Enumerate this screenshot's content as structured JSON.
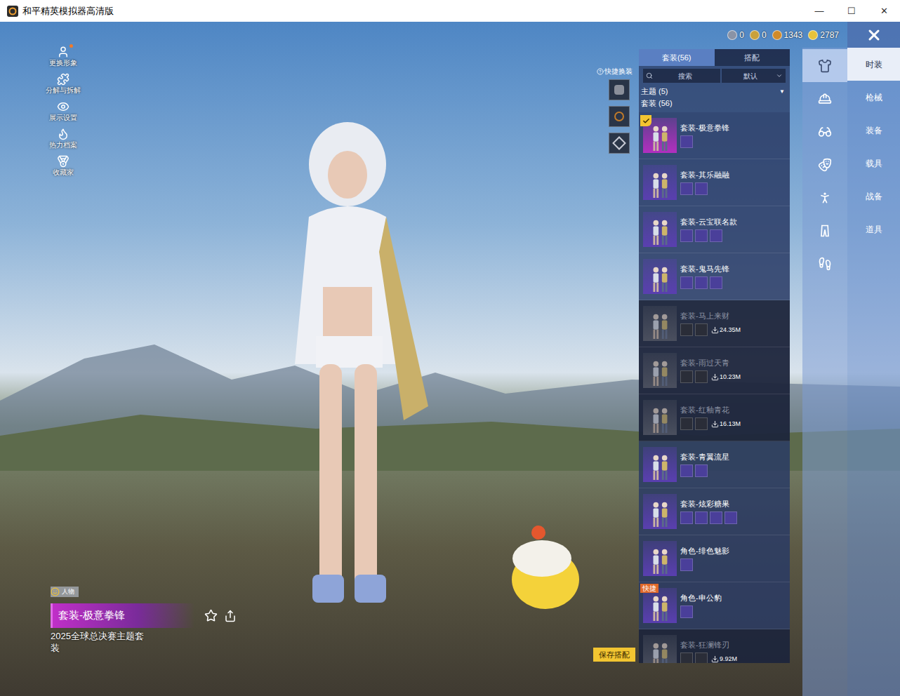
{
  "window": {
    "title": "和平精英模拟器高清版",
    "controls": [
      "—",
      "☐",
      "✕"
    ]
  },
  "left_menu": [
    {
      "label": "更换形象",
      "dot": true,
      "kind": "avatar"
    },
    {
      "label": "分解与拆解",
      "dot": false,
      "kind": "puzzle"
    },
    {
      "label": "展示设置",
      "dot": false,
      "kind": "eye"
    },
    {
      "label": "热力档案",
      "dot": false,
      "kind": "flame"
    },
    {
      "label": "收藏家",
      "dot": false,
      "kind": "medal"
    }
  ],
  "currencies": [
    {
      "value": "0",
      "color": "#8a93a6"
    },
    {
      "value": "0",
      "color": "#c9a13b"
    },
    {
      "value": "1343",
      "color": "#d08a2a"
    },
    {
      "value": "2787",
      "color": "#e6c23a"
    }
  ],
  "quick_change": {
    "label": "快捷换装"
  },
  "tabs": [
    {
      "label": "套装(56)",
      "selected": true
    },
    {
      "label": "搭配",
      "selected": false
    }
  ],
  "search": {
    "placeholder": "搜索",
    "sort": "默认"
  },
  "filters": [
    {
      "label": "主题 (5)",
      "expanded": false
    },
    {
      "label": "套装 (56)"
    }
  ],
  "list": [
    {
      "name": "套装-极意拳锋",
      "parts": 1,
      "downloaded": true,
      "size": "",
      "selected": true,
      "badge": "",
      "color": "#b22fc0"
    },
    {
      "name": "套装-其乐融融",
      "parts": 2,
      "downloaded": true,
      "size": "",
      "selected": false,
      "badge": "",
      "color": "#5a3fb0"
    },
    {
      "name": "套装-云宝联名款",
      "parts": 3,
      "downloaded": true,
      "size": "",
      "selected": false,
      "badge": "",
      "color": "#5a3fb0"
    },
    {
      "name": "套装-鬼马先锋",
      "parts": 3,
      "downloaded": true,
      "size": "",
      "selected": false,
      "badge": "",
      "color": "#5a3fb0"
    },
    {
      "name": "套装-马上来财",
      "parts": 2,
      "downloaded": false,
      "size": "24.35M",
      "selected": false,
      "badge": "",
      "color": "#4a4f5e"
    },
    {
      "name": "套装-雨过天青",
      "parts": 2,
      "downloaded": false,
      "size": "10.23M",
      "selected": false,
      "badge": "",
      "color": "#4a4f5e"
    },
    {
      "name": "套装-红釉青花",
      "parts": 2,
      "downloaded": false,
      "size": "16.13M",
      "selected": false,
      "badge": "",
      "color": "#4a4f5e"
    },
    {
      "name": "套装-青翼流星",
      "parts": 2,
      "downloaded": true,
      "size": "",
      "selected": false,
      "badge": "",
      "color": "#5a3fb0"
    },
    {
      "name": "套装-炫彩糖果",
      "parts": 4,
      "downloaded": true,
      "size": "",
      "selected": false,
      "badge": "",
      "color": "#5a3fb0"
    },
    {
      "name": "角色-绯色魅影",
      "parts": 1,
      "downloaded": true,
      "size": "",
      "selected": false,
      "badge": "",
      "color": "#5a3fb0"
    },
    {
      "name": "角色-申公豹",
      "parts": 1,
      "downloaded": true,
      "size": "",
      "selected": false,
      "badge": "快捷",
      "color": "#5a3fb0"
    },
    {
      "name": "套装-狂澜锋刃",
      "parts": 2,
      "downloaded": false,
      "size": "9.92M",
      "selected": false,
      "badge": "",
      "color": "#4a4f5e"
    }
  ],
  "categories": [
    {
      "kind": "outfit",
      "selected": true
    },
    {
      "kind": "hat",
      "selected": false
    },
    {
      "kind": "glasses",
      "selected": false
    },
    {
      "kind": "mask",
      "selected": false
    },
    {
      "kind": "body",
      "selected": false
    },
    {
      "kind": "pants",
      "selected": false
    },
    {
      "kind": "shoes",
      "selected": false
    }
  ],
  "sections": [
    {
      "label": "时装",
      "selected": true
    },
    {
      "label": "枪械",
      "selected": false
    },
    {
      "label": "装备",
      "selected": false
    },
    {
      "label": "载具",
      "selected": false
    },
    {
      "label": "战备",
      "selected": false
    },
    {
      "label": "道具",
      "selected": false
    }
  ],
  "preview": {
    "tag": "人物",
    "name": "套装-极意拳锋",
    "description": "2025全球总决赛主题套装"
  },
  "save_button": "保存搭配"
}
